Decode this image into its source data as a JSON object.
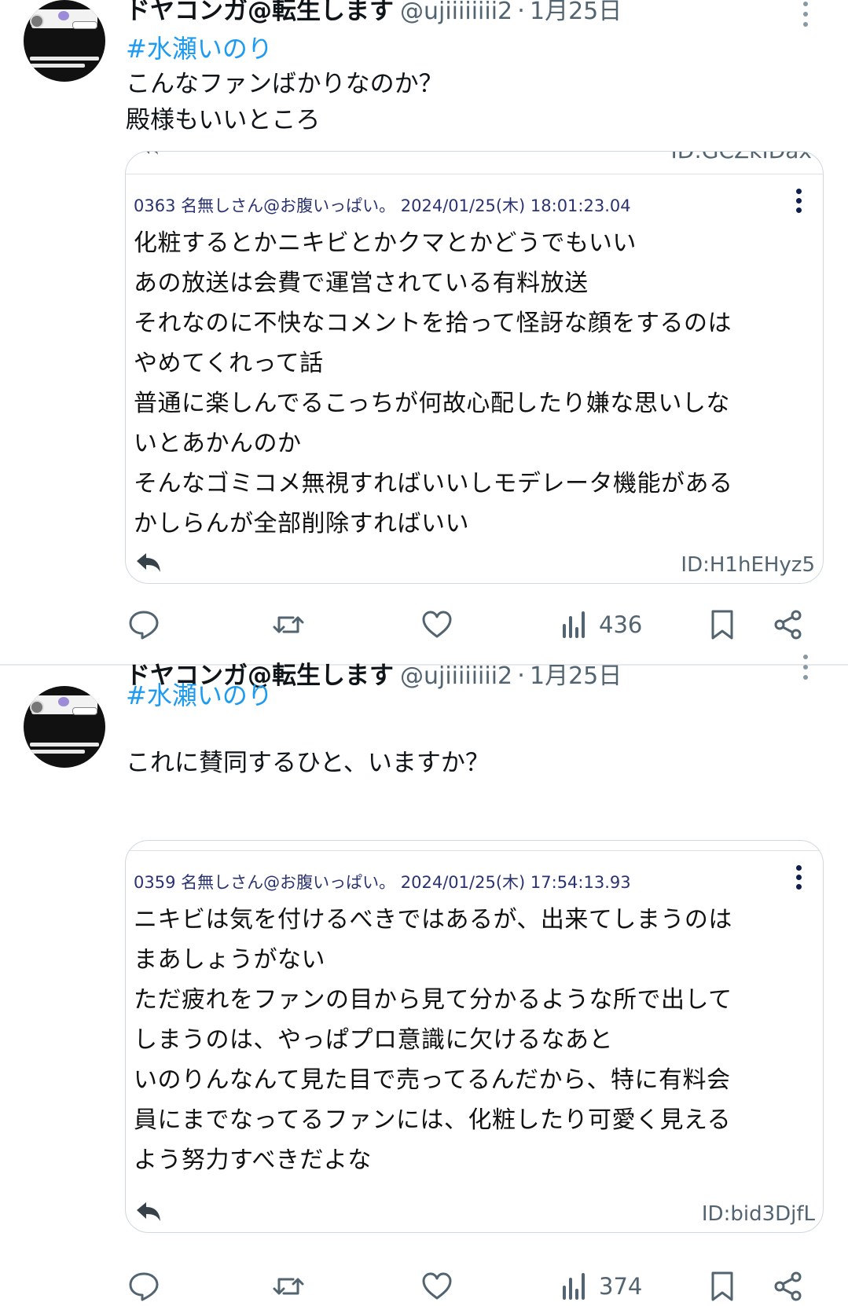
{
  "posts": [
    {
      "display_name": "ドヤコンガ@転生します",
      "handle": "@ujiiiiiiii2",
      "separator": "·",
      "timestamp": "1月25日",
      "hashtag": "#水瀬いのり",
      "text_lines": [
        "こんなファンばかりなのか？",
        "殿様もいいところ"
      ],
      "quote": {
        "top_id": "ID:GCZkIDax",
        "res_header": "0363 名無しさん@お腹いっぱい。 2024/01/25(木) 18:01:23.04",
        "body_lines": [
          "化粧するとかニキビとかクマとかどうでもいい",
          "あの放送は会費で運営されている有料放送",
          "それなのに不快なコメントを拾って怪訝な顔をするのは",
          "やめてくれって話",
          "普通に楽しんでるこっちが何故心配したり嫌な思いしな",
          "いとあかんのか",
          "そんなゴミコメ無視すればいいしモデレータ機能がある",
          "かしらんが全部削除すればいい"
        ],
        "id": "ID:H1hEHyz5"
      },
      "views": "436"
    },
    {
      "display_name": "ドヤコンガ@転生します",
      "handle": "@ujiiiiiiii2",
      "separator": "·",
      "timestamp": "1月25日",
      "hashtag": "#水瀬いのり",
      "text_lines": [
        "これに賛同するひと、いますか？"
      ],
      "quote": {
        "res_header": "0359 名無しさん@お腹いっぱい。 2024/01/25(木) 17:54:13.93",
        "body_lines": [
          "ニキビは気を付けるべきではあるが、出来てしまうのは",
          "まあしょうがない",
          "ただ疲れをファンの目から見て分かるような所で出して",
          "しまうのは、やっぱプロ意識に欠けるなあと",
          "いのりんなんて見た目で売ってるんだから、特に有料会",
          "員にまでなってるファンには、化粧したり可愛く見える",
          "よう努力すべきだよな"
        ],
        "id": "ID:bid3DjfL"
      },
      "views": "374"
    }
  ],
  "colors": {
    "hashtag": "#1d9bf0",
    "muted": "#536471",
    "res_header": "#2a3370",
    "border": "#cfd9de"
  },
  "icons": [
    "reply-icon",
    "retweet-icon",
    "like-icon",
    "views-icon",
    "bookmark-icon",
    "share-icon",
    "more-icon",
    "quote-reply-icon"
  ]
}
